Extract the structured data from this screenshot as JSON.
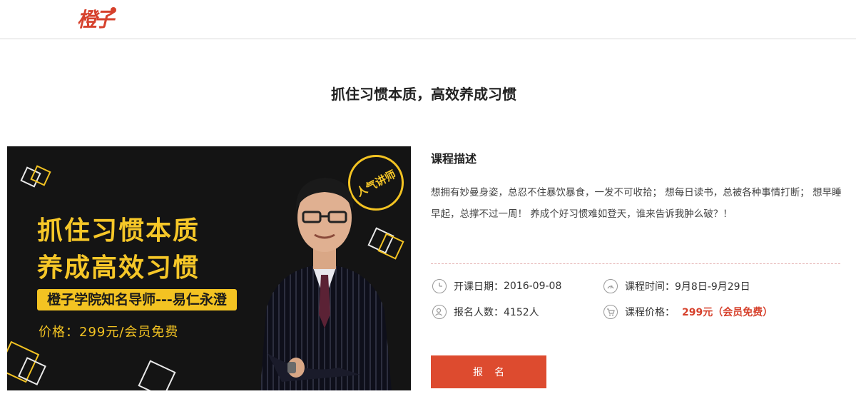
{
  "header": {
    "logo_text": "橙子"
  },
  "page": {
    "title": "抓住习惯本质，高效养成习惯"
  },
  "banner": {
    "headline_1": "抓住习惯本质",
    "headline_2": "养成高效习惯",
    "teacher_tag": "橙子学院知名导师---易仁永澄",
    "price_line": "价格：299元/会员免费",
    "seal_text": "人气讲师"
  },
  "course": {
    "desc_title": "课程描述",
    "desc_text": "想拥有妙曼身姿，总忍不住暴饮暴食，一发不可收拾； 想每日读书，总被各种事情打断； 想早睡早起，总撑不过一周！ 养成个好习惯难如登天，谁来告诉我肿么破？！",
    "start_date_label": "开课日期：",
    "start_date_value": "2016-09-08",
    "period_label": "课程时间：",
    "period_value": "9月8日-9月29日",
    "enrolled_label": "报名人数：",
    "enrolled_value": "4152人",
    "price_label": "课程价格：",
    "price_value": "299元（会员免费）",
    "signup_label": "报名"
  },
  "colors": {
    "brand": "#dd4b2f",
    "banner_bg": "#141414",
    "banner_accent": "#f3c322"
  },
  "icons": [
    "clock-icon",
    "gauge-icon",
    "people-icon",
    "cart-icon"
  ]
}
